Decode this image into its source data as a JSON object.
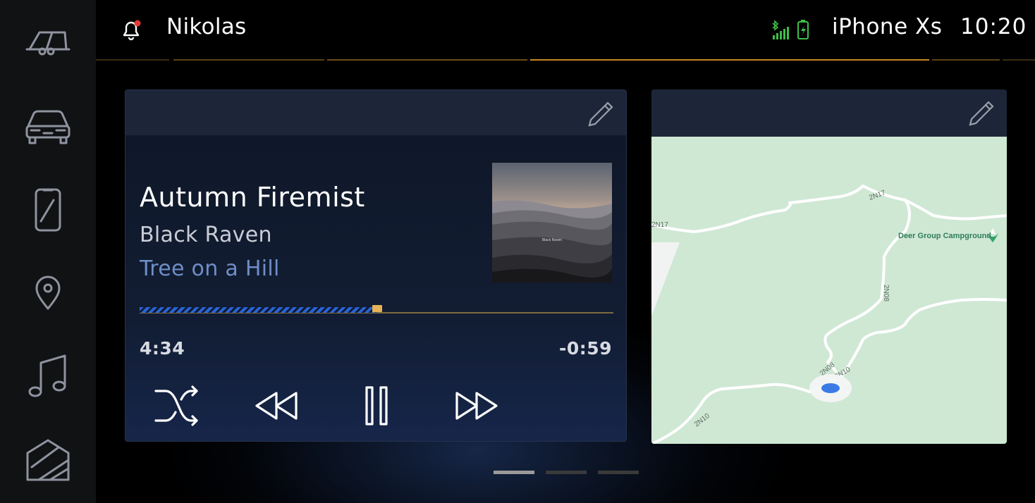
{
  "colors": {
    "background": "#000000",
    "sidebar": "#111214",
    "accent_orange": "#c8861e",
    "progress_blue": "#2a63d6",
    "album_link": "#6f8ec8",
    "notification_dot": "#e53935",
    "signal_green": "#3fbf4a",
    "map_land": "#cfe8d4",
    "location_blue": "#3b7be6"
  },
  "sidebar": {
    "items": [
      {
        "name": "trailer",
        "icon": "trailer-icon"
      },
      {
        "name": "vehicle",
        "icon": "car-icon"
      },
      {
        "name": "phone",
        "icon": "phone-icon"
      },
      {
        "name": "navigation",
        "icon": "location-pin-icon"
      },
      {
        "name": "media",
        "icon": "music-note-icon"
      },
      {
        "name": "home",
        "icon": "home-icon"
      }
    ]
  },
  "header": {
    "user_name": "Nikolas",
    "has_notification": true,
    "device_name": "iPhone Xs",
    "time": "10:20"
  },
  "media_card": {
    "track_title": "Autumn Firemist",
    "artist": "Black Raven",
    "album": "Tree on a Hill",
    "cover_text": "Black Raven",
    "elapsed": "4:34",
    "remaining": "-0:59",
    "progress_fraction": 0.5,
    "controls": [
      "shuffle-icon",
      "rewind-icon",
      "pause-icon",
      "fast-forward-icon"
    ]
  },
  "map_card": {
    "poi": "Deer Group Campground",
    "road_labels": [
      "2N17",
      "2N17",
      "2N08",
      "2N08",
      "2N10",
      "2N10"
    ]
  },
  "pagination": {
    "pages": 3,
    "active": 0
  }
}
